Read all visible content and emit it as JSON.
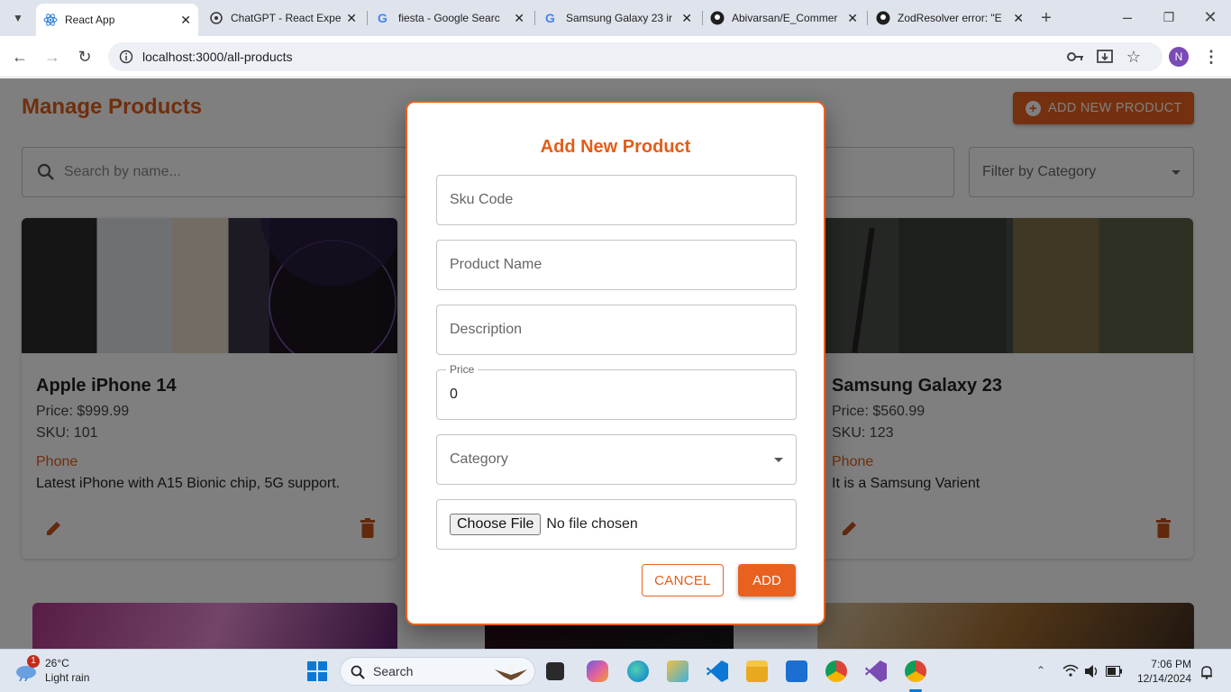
{
  "browser": {
    "tabs": [
      {
        "title": "React App",
        "active": true
      },
      {
        "title": "ChatGPT - React Expe"
      },
      {
        "title": "fiesta - Google Searc"
      },
      {
        "title": "Samsung Galaxy 23 ir"
      },
      {
        "title": "Abivarsan/E_Commer"
      },
      {
        "title": "ZodResolver error: \"E"
      }
    ],
    "url": "localhost:3000/all-products",
    "profile_initial": "N"
  },
  "page": {
    "title": "Manage Products",
    "add_button": "ADD NEW PRODUCT",
    "search_placeholder": "Search by name...",
    "filter_label": "Filter by Category"
  },
  "products": [
    {
      "name": "Apple iPhone 14",
      "price": "Price: $999.99",
      "sku": "SKU: 101",
      "category": "Phone",
      "description": "Latest iPhone with A15 Bionic chip, 5G support."
    },
    {
      "name": "Samsung Galaxy 23",
      "price": "Price: $560.99",
      "sku": "SKU: 123",
      "category": "Phone",
      "description": "It is a Samsung Varient"
    }
  ],
  "dialog": {
    "title": "Add New Product",
    "sku_placeholder": "Sku Code",
    "name_placeholder": "Product Name",
    "description_placeholder": "Description",
    "price_label": "Price",
    "price_value": "0",
    "category_placeholder": "Category",
    "file_button": "Choose File",
    "file_status": "No file chosen",
    "cancel": "CANCEL",
    "add": "ADD"
  },
  "taskbar": {
    "weather_temp": "26°C",
    "weather_desc": "Light rain",
    "weather_badge": "1",
    "search_label": "Search",
    "time": "7:06 PM",
    "date": "12/14/2024"
  },
  "colors": {
    "accent": "#e8611f",
    "heading": "#e35d18"
  }
}
